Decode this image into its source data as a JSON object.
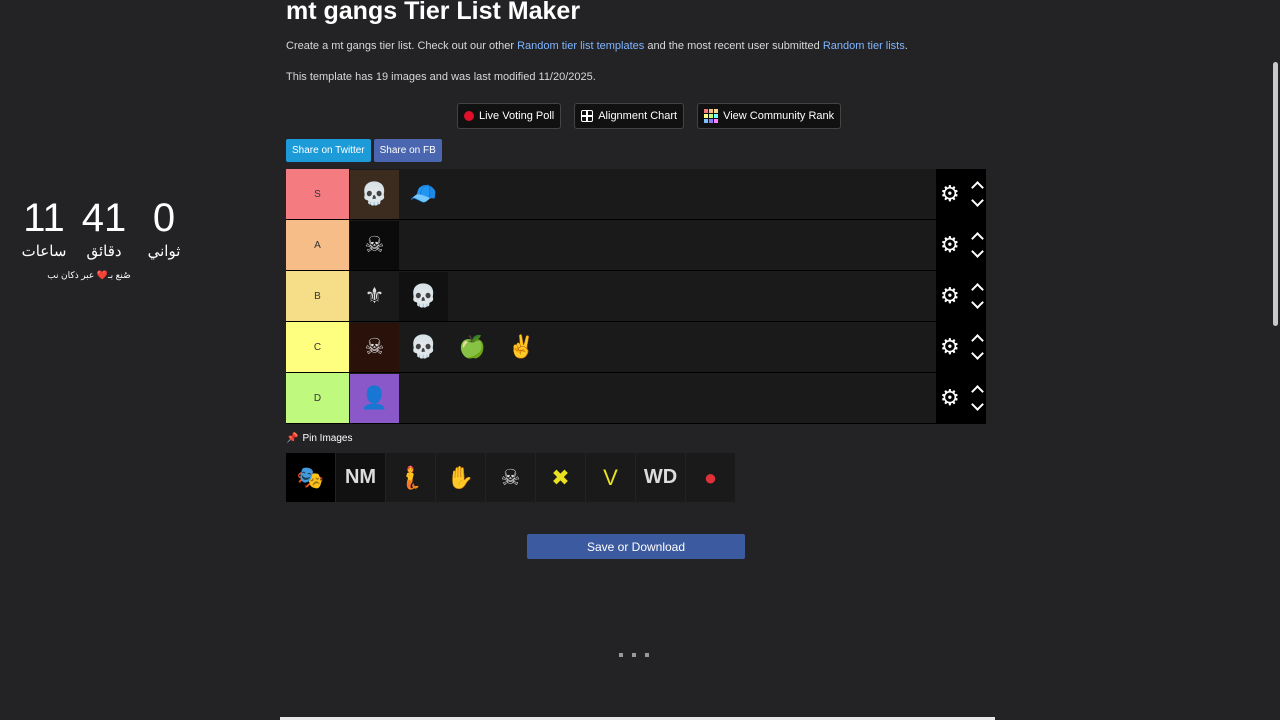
{
  "countdown": {
    "hours": "11",
    "hours_label": "ساعات",
    "minutes": "41",
    "minutes_label": "دقائق",
    "seconds": "0",
    "seconds_label": "ثواني",
    "credit": "صُنع بـ❤️ عبر ذكان نب"
  },
  "page": {
    "title": "mt gangs Tier List Maker",
    "intro_prefix": "Create a mt gangs tier list. Check out our other ",
    "intro_link1": "Random tier list templates",
    "intro_middle": " and the most recent user submitted ",
    "intro_link2": "Random tier lists",
    "intro_suffix": ".",
    "meta": "This template has 19 images and was last modified 11/20/2025."
  },
  "tools": {
    "live_poll": "Live Voting Poll",
    "alignment": "Alignment Chart",
    "community": "View Community Rank"
  },
  "share": {
    "twitter": "Share on Twitter",
    "fb": "Share on FB",
    "twitter_color": "#1da1f2",
    "fb_color": "#4267b2"
  },
  "tiers": [
    {
      "label": "S",
      "color": "#f47b80",
      "items": [
        "skull-tree-logo",
        "green-gang-logo"
      ]
    },
    {
      "label": "A",
      "color": "#f6bd88",
      "items": [
        "gang-logo"
      ]
    },
    {
      "label": "B",
      "color": "#f6dd88",
      "items": [
        "xlr-logo",
        "skull-logo"
      ]
    },
    {
      "label": "C",
      "color": "#fefe7f",
      "items": [
        "26-yard-logo",
        "blue-skull-logo",
        "green-apple-logo",
        "shadow-logo"
      ]
    },
    {
      "label": "D",
      "color": "#bff97e",
      "items": [
        "purple-photo"
      ]
    }
  ],
  "pin": {
    "label": "Pin Images"
  },
  "pool": [
    "mask-image",
    "nm-logo",
    "mermaid-logo",
    "hand-logo",
    "grim-reaper-logo",
    "trickster-logo",
    "vagos-logo",
    "wd-logo",
    "red-logo"
  ],
  "save": {
    "label": "Save or Download"
  }
}
